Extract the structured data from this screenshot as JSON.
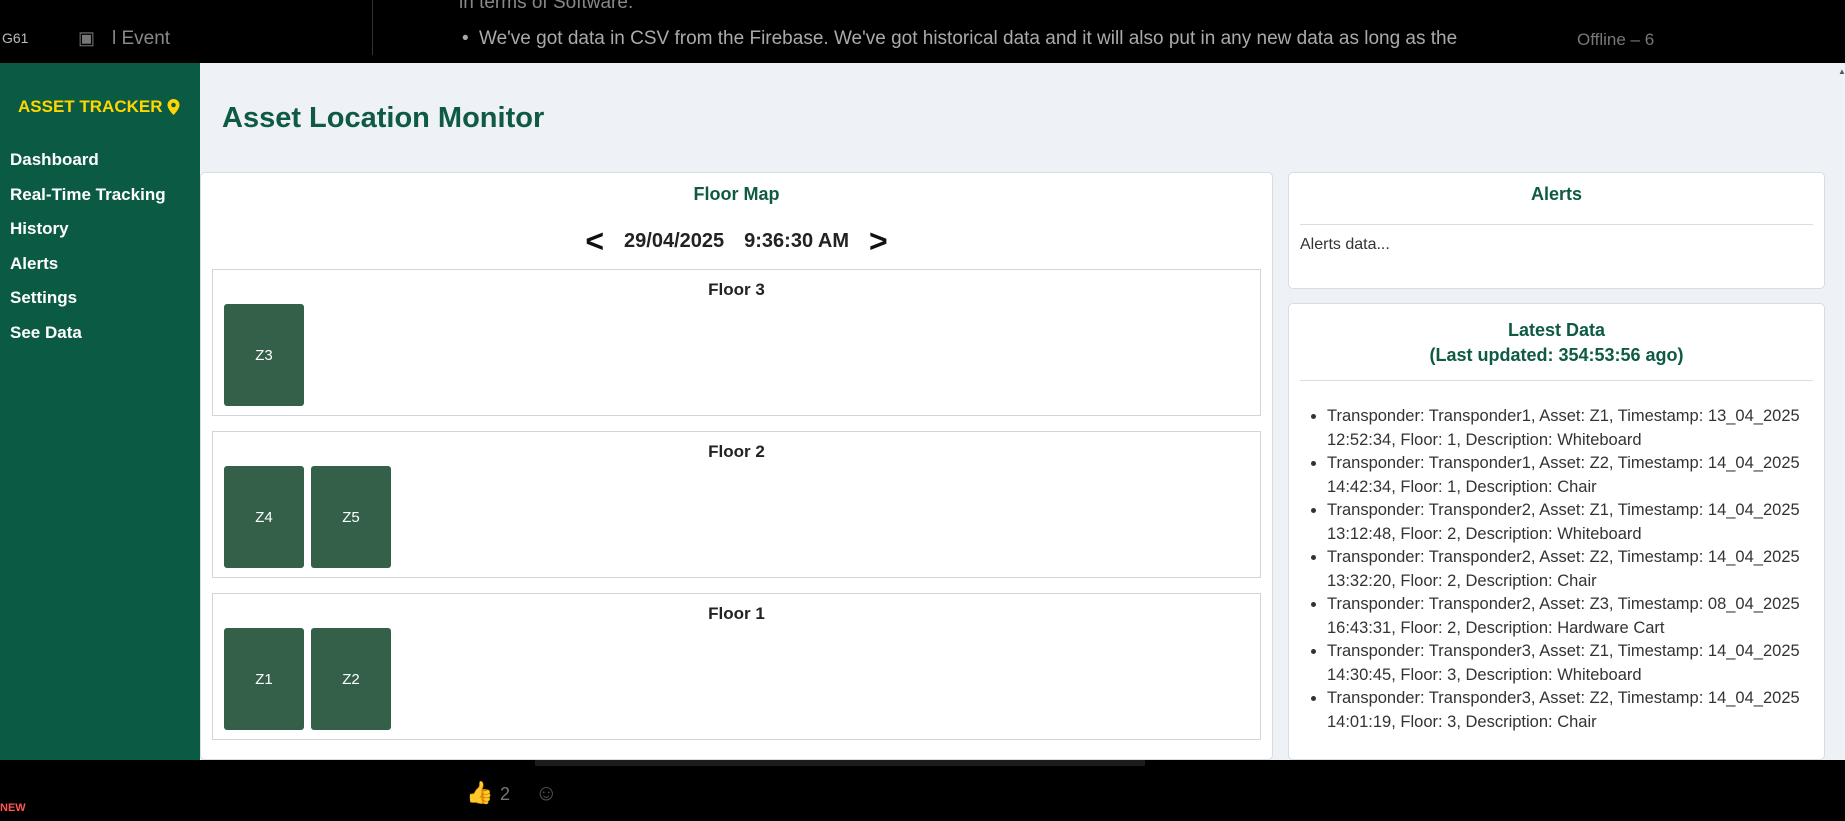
{
  "background": {
    "top_left": "G61",
    "event_label": "l Event",
    "line_top": "in terms of Software.",
    "bullet_text": "We've got data in CSV from the Firebase. We've got historical data and it will also put in any new data as long as the",
    "status_text": "Offline – 6",
    "like_count": "2",
    "new_badge": "NEW"
  },
  "sidebar": {
    "brand": "ASSET TRACKER",
    "items": [
      "Dashboard",
      "Real-Time Tracking",
      "History",
      "Alerts",
      "Settings",
      "See Data"
    ]
  },
  "page_title": "Asset Location Monitor",
  "floor_map": {
    "title": "Floor Map",
    "date": "29/04/2025",
    "time": "9:36:30 AM",
    "prev": "<",
    "next": ">",
    "floors": [
      {
        "label": "Floor 3",
        "zones": [
          "Z3"
        ]
      },
      {
        "label": "Floor 2",
        "zones": [
          "Z4",
          "Z5"
        ]
      },
      {
        "label": "Floor 1",
        "zones": [
          "Z1",
          "Z2"
        ]
      }
    ]
  },
  "alerts": {
    "title": "Alerts",
    "text": "Alerts data..."
  },
  "latest": {
    "title": "Latest Data",
    "subtitle": "(Last updated: 354:53:56 ago)",
    "items": [
      "Transponder: Transponder1, Asset: Z1, Timestamp: 13_04_2025 12:52:34, Floor: 1, Description: Whiteboard",
      "Transponder: Transponder1, Asset: Z2, Timestamp: 14_04_2025 14:42:34, Floor: 1, Description: Chair",
      "Transponder: Transponder2, Asset: Z1, Timestamp: 14_04_2025 13:12:48, Floor: 2, Description: Whiteboard",
      "Transponder: Transponder2, Asset: Z2, Timestamp: 14_04_2025 13:32:20, Floor: 2, Description: Chair",
      "Transponder: Transponder2, Asset: Z3, Timestamp: 08_04_2025 16:43:31, Floor: 2, Description: Hardware Cart",
      "Transponder: Transponder3, Asset: Z1, Timestamp: 14_04_2025 14:30:45, Floor: 3, Description: Whiteboard",
      "Transponder: Transponder3, Asset: Z2, Timestamp: 14_04_2025 14:01:19, Floor: 3, Description: Chair"
    ]
  },
  "colors": {
    "sidebar_bg": "#0b5a44",
    "brand": "#ffd600",
    "accent": "#0e5a44",
    "zone": "#34604a",
    "page_bg": "#eef2f7"
  },
  "icons": {
    "brand_icon": "map-pin-icon",
    "calendar_icon": "calendar-icon",
    "like_icon": "thumbs-up-icon",
    "emoji_icon": "smiley-icon"
  }
}
